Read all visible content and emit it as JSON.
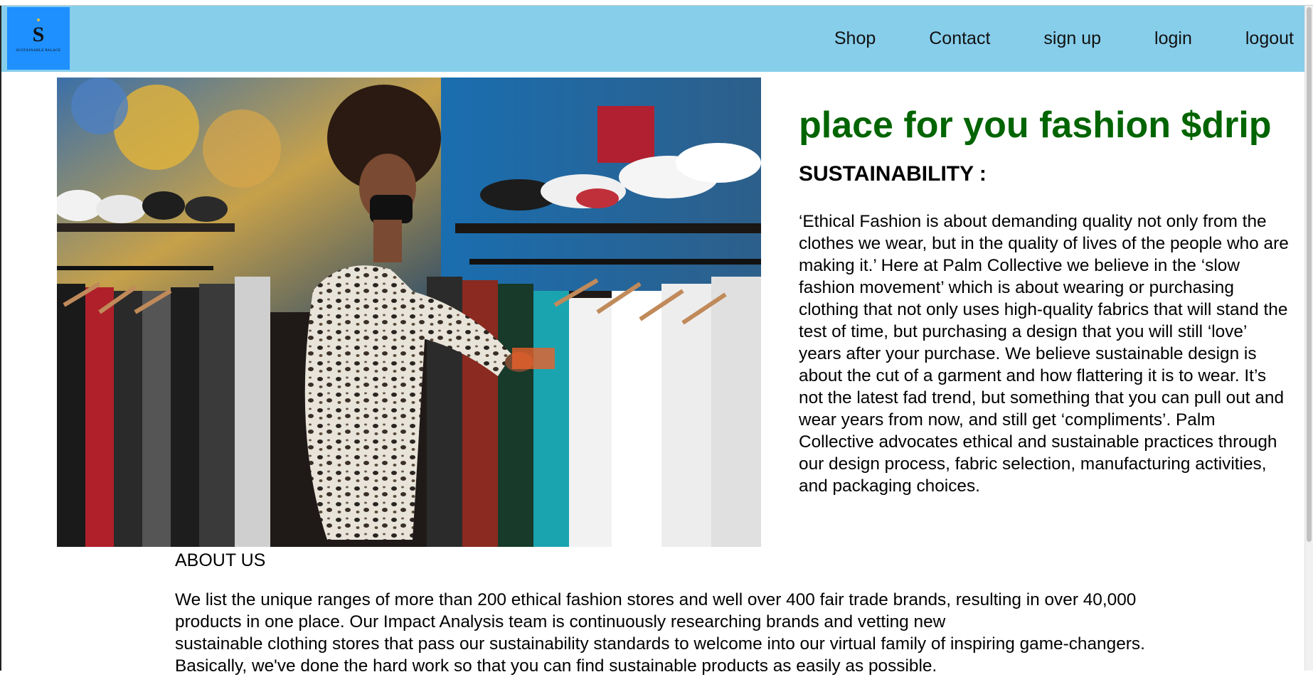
{
  "navbar": {
    "logo": {
      "mark": "S",
      "text": "SUSTAINABLE PALACE"
    },
    "links": [
      "Shop",
      "Contact",
      "sign up",
      "login",
      "logout"
    ],
    "background": "#87ceeb",
    "logo_background": "#1e90ff"
  },
  "hero": {
    "image_icon": "clothing-store-photo",
    "title": "place for you fashion $drip",
    "title_color": "#006400",
    "section_title": "SUSTAINABILITY :",
    "paragraph": "‘Ethical Fashion is about demanding quality not only from the clothes we wear, but in the quality of lives of the people who are making it.’ Here at Palm Collective we believe in the ‘slow fashion movement’ which is about wearing or purchasing clothing that not only uses high-quality fabrics that will stand the test of time, but purchasing a design that you will still ‘love’ years after your purchase. We believe sustainable design is about the cut of a garment and how flattering it is to wear. It’s not the latest fad trend, but something that you can pull out and wear years from now, and still get ‘compliments’. Palm Collective advocates ethical and sustainable practices through our design process, fabric selection, manufacturing activities, and packaging choices."
  },
  "about": {
    "title": "ABOUT US",
    "lines": [
      "We list the unique ranges of more than 200 ethical fashion stores and well over 400 fair trade brands, resulting in over 40,000",
      "products in one place. Our Impact Analysis team is continuously researching brands and vetting new",
      "sustainable clothing stores that pass our sustainability standards to welcome into our virtual family of inspiring game-changers.",
      "Basically, we've done the hard work so that you can find sustainable products as easily as possible."
    ]
  }
}
